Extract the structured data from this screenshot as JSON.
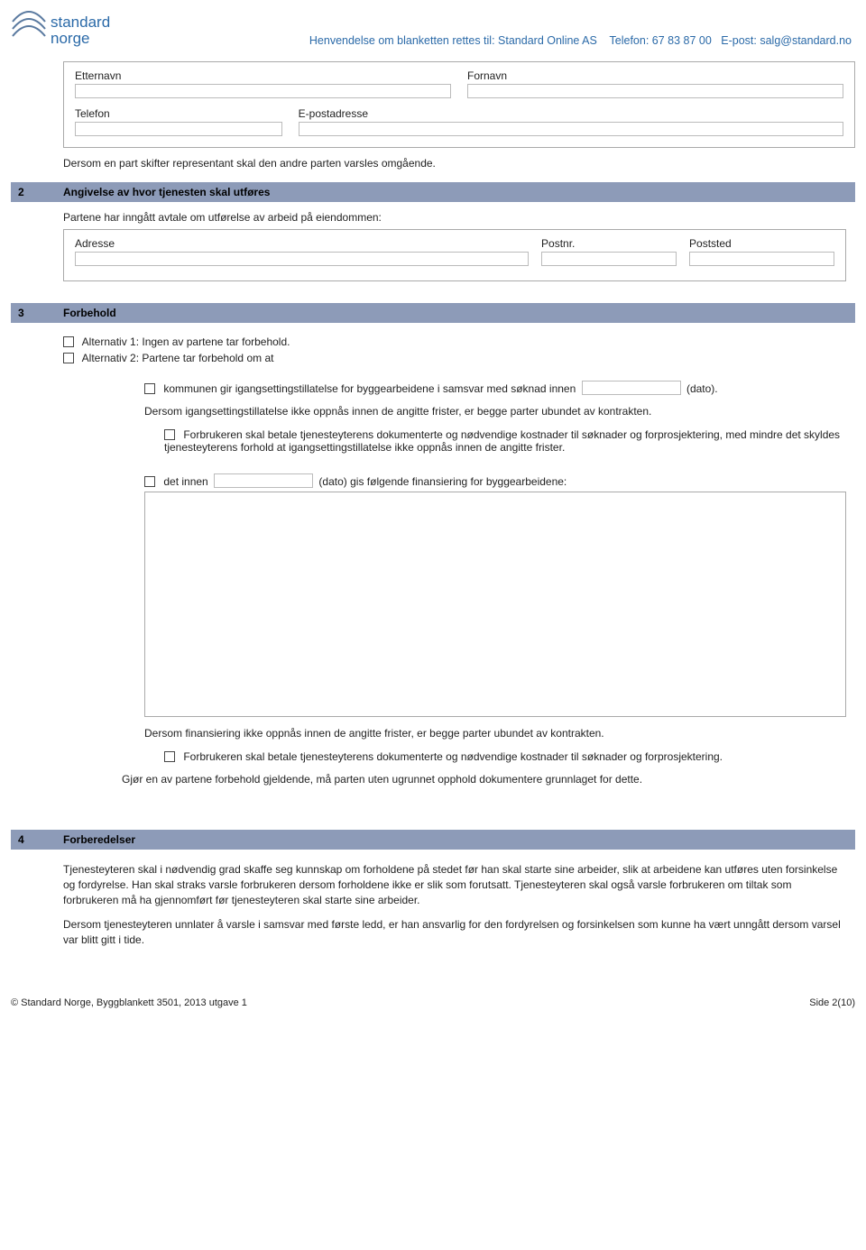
{
  "header": {
    "logo_top": "standard",
    "logo_bottom": "norge",
    "contact_prefix": "Henvendelse om blanketten rettes til: Standard Online AS",
    "phone_label": "Telefon:",
    "phone_value": "67 83 87 00",
    "email_label": "E-post:",
    "email_value": "salg@standard.no"
  },
  "section1": {
    "fields": {
      "etternavn": "Etternavn",
      "fornavn": "Fornavn",
      "telefon": "Telefon",
      "epost": "E-postadresse"
    },
    "note": "Dersom en part skifter representant skal den andre parten varsles omgående."
  },
  "section2": {
    "num": "2",
    "title": "Angivelse av hvor tjenesten skal utføres",
    "intro": "Partene har inngått avtale om utførelse av arbeid på eiendommen:",
    "fields": {
      "adresse": "Adresse",
      "postnr": "Postnr.",
      "poststed": "Poststed"
    }
  },
  "section3": {
    "num": "3",
    "title": "Forbehold",
    "alt1": "Alternativ 1: Ingen av partene tar forbehold.",
    "alt2": "Alternativ 2: Partene tar forbehold om at",
    "kommune_line": "kommunen gir igangsettingstillatelse for byggearbeidene i samsvar med søknad innen",
    "dato_suffix": "(dato).",
    "kommune_para": "Dersom igangsettingstillatelse ikke oppnås innen de angitte frister, er begge parter ubundet av kontrakten.",
    "forbruker_line": "Forbrukeren skal betale tjenesteyterens dokumenterte og nødvendige kostnader til søknader og forprosjektering, med mindre det skyldes tjenesteyterens forhold at igangsettingstillatelse ikke oppnås innen de angitte frister.",
    "detinnen_prefix": "det innen",
    "detinnen_suffix": "(dato) gis følgende finansiering for byggearbeidene:",
    "finans_para": "Dersom finansiering ikke oppnås innen de angitte frister, er begge parter ubundet av kontrakten.",
    "forbruker_line2": "Forbrukeren skal betale tjenesteyterens dokumenterte og nødvendige kostnader til søknader og forprosjektering.",
    "closing": "Gjør en av partene forbehold gjeldende, må parten uten ugrunnet opphold dokumentere grunnlaget for dette."
  },
  "section4": {
    "num": "4",
    "title": "Forberedelser",
    "p1": "Tjenesteyteren skal i nødvendig grad skaffe seg kunnskap om forholdene på stedet før han skal starte sine arbeider, slik at arbeidene kan utføres uten forsinkelse og fordyrelse. Han skal straks varsle forbrukeren dersom forholdene ikke er slik som forutsatt. Tjenesteyteren skal også varsle forbrukeren om tiltak som forbrukeren må ha gjennomført før tjenesteyteren skal starte sine arbeider.",
    "p2": "Dersom tjenesteyteren unnlater å varsle i samsvar med første ledd, er han ansvarlig for den fordyrelsen og forsinkelsen som kunne ha vært unngått dersom varsel var blitt gitt i tide."
  },
  "footer": {
    "left": "© Standard Norge, Byggblankett 3501,  2013 utgave 1",
    "right": "Side 2(10)"
  }
}
